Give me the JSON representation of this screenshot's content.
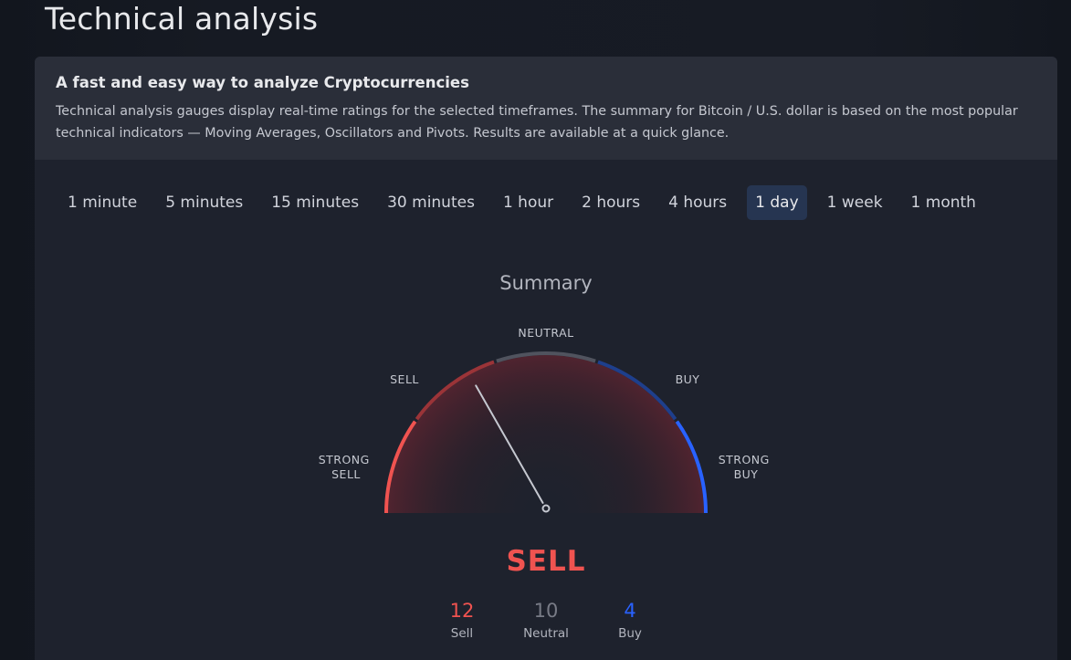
{
  "page_title": "Technical analysis",
  "intro": {
    "title": "A fast and easy way to analyze Cryptocurrencies",
    "text": "Technical analysis gauges display real-time ratings for the selected timeframes. The summary for Bitcoin / U.S. dollar is based on the most popular technical indicators — Moving Averages, Oscillators and Pivots. Results are available at a quick glance."
  },
  "timeframes": [
    {
      "label": "1 minute",
      "active": false
    },
    {
      "label": "5 minutes",
      "active": false
    },
    {
      "label": "15 minutes",
      "active": false
    },
    {
      "label": "30 minutes",
      "active": false
    },
    {
      "label": "1 hour",
      "active": false
    },
    {
      "label": "2 hours",
      "active": false
    },
    {
      "label": "4 hours",
      "active": false
    },
    {
      "label": "1 day",
      "active": true
    },
    {
      "label": "1 week",
      "active": false
    },
    {
      "label": "1 month",
      "active": false
    }
  ],
  "summary": {
    "title": "Summary",
    "gauge_labels": {
      "strong_sell": [
        "STRONG",
        "SELL"
      ],
      "sell": "SELL",
      "neutral": "NEUTRAL",
      "buy": "BUY",
      "strong_buy": [
        "STRONG",
        "BUY"
      ]
    },
    "needle_rating": -0.33,
    "verdict": "SELL",
    "counts": {
      "sell": {
        "value": "12",
        "label": "Sell"
      },
      "neutral": {
        "value": "10",
        "label": "Neutral"
      },
      "buy": {
        "value": "4",
        "label": "Buy"
      }
    }
  },
  "colors": {
    "strong_sell": "#f05350",
    "sell": "#9b3438",
    "neutral": "#50535e",
    "buy": "#1e3f8c",
    "strong_buy": "#2962ff",
    "active_tab_bg": "#263551"
  }
}
